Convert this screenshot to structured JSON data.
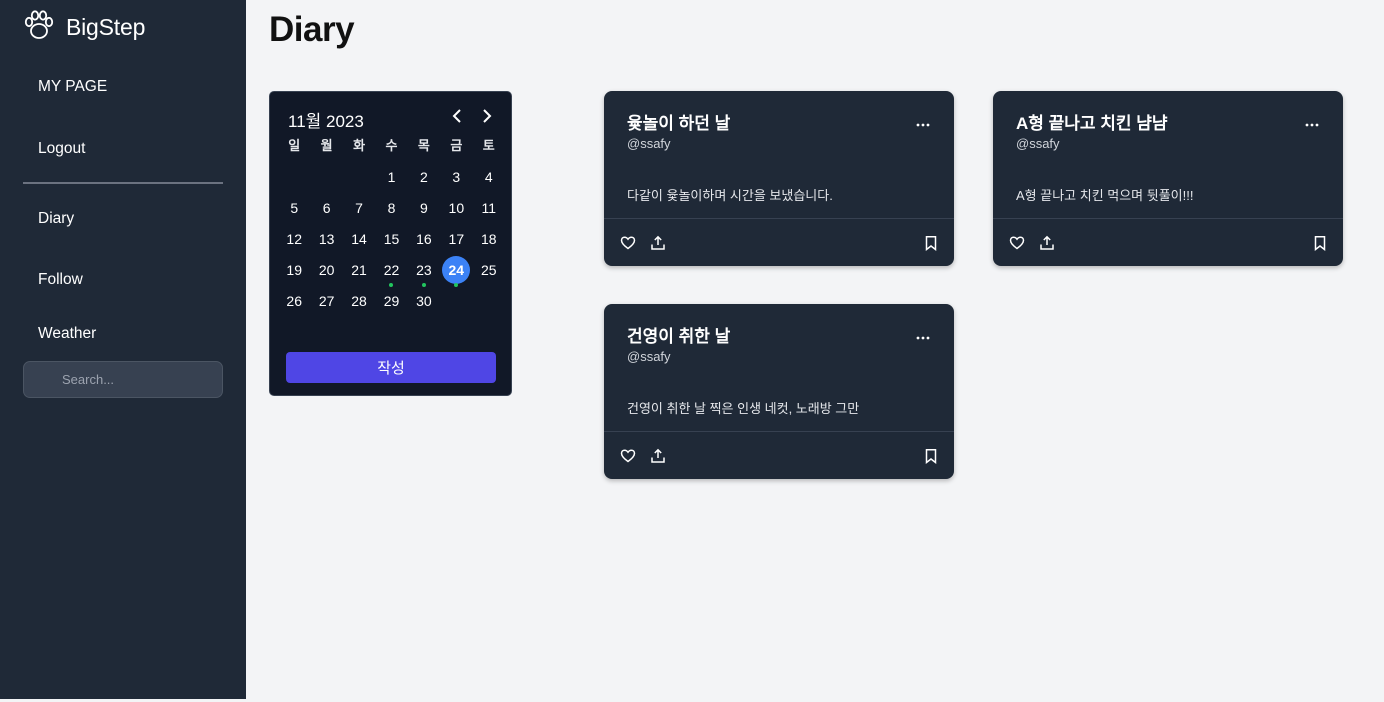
{
  "brand": {
    "name": "BigStep"
  },
  "nav": {
    "mypage": "MY PAGE",
    "logout": "Logout",
    "diary": "Diary",
    "follow": "Follow",
    "weather": "Weather"
  },
  "search": {
    "placeholder": "Search..."
  },
  "page": {
    "title": "Diary"
  },
  "calendar": {
    "month_label": "11월 2023",
    "weekdays": [
      "일",
      "월",
      "화",
      "수",
      "목",
      "금",
      "토"
    ],
    "weeks": [
      [
        "",
        "",
        "",
        "1",
        "2",
        "3",
        "4"
      ],
      [
        "5",
        "6",
        "7",
        "8",
        "9",
        "10",
        "11"
      ],
      [
        "12",
        "13",
        "14",
        "15",
        "16",
        "17",
        "18"
      ],
      [
        "19",
        "20",
        "21",
        "22",
        "23",
        "24",
        "25"
      ],
      [
        "26",
        "27",
        "28",
        "29",
        "30",
        "",
        ""
      ]
    ],
    "selected_day": "24",
    "marked_days": [
      "22",
      "23",
      "24"
    ],
    "write_button": "작성"
  },
  "cards": [
    {
      "title": "윷놀이 하던 날",
      "author": "@ssafy",
      "content": "다같이 윷놀이하며 시간을 보냈습니다."
    },
    {
      "title": "A형 끝나고 치킨 냠냠",
      "author": "@ssafy",
      "content": "A형 끝나고 치킨 먹으며 뒷풀이!!!"
    },
    {
      "title": "건영이 취한 날",
      "author": "@ssafy",
      "content": "건영이 취한 날 찍은 인생 네컷, 노래방 그만"
    }
  ],
  "colors": {
    "sidebar_bg": "#1f2937",
    "card_bg": "#1f2937",
    "calendar_bg": "#111827",
    "accent_button": "#4f46e5",
    "selected_day": "#3b82f6",
    "marked_dot": "#22c55e"
  }
}
